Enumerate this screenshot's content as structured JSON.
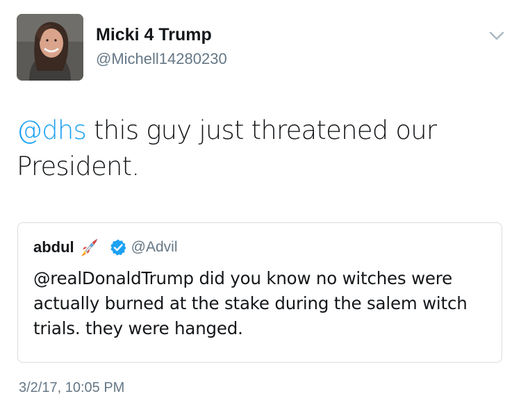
{
  "author": {
    "display_name": "Micki 4 Trump",
    "handle": "@Michell14280230",
    "avatar_icon": "profile-photo"
  },
  "tweet": {
    "mention": "@dhs",
    "text": " this guy just threatened our President."
  },
  "quoted_tweet": {
    "display_name": "abdul",
    "emoji_icon": "rocket-icon",
    "verified_icon": "verified-badge-icon",
    "handle": "@Advil",
    "text": "@realDonaldTrump did you know no witches were actually burned at the stake during the salem witch trials. they were hanged."
  },
  "timestamp": "3/2/17, 10:05 PM",
  "colors": {
    "link": "#1da1f2",
    "secondary_text": "#657786",
    "border": "#d8dde1",
    "verified": "#1da1f2"
  }
}
